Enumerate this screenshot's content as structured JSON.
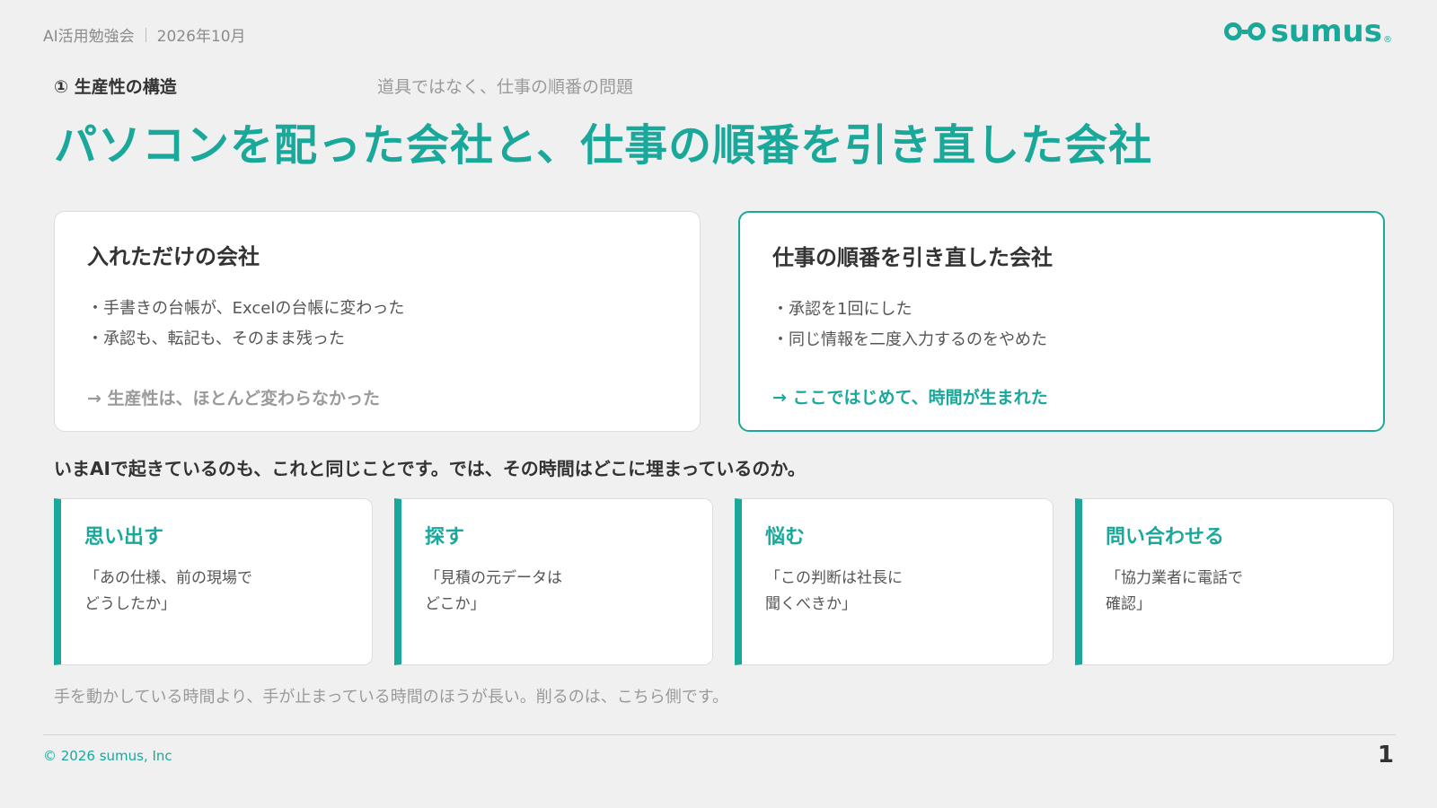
{
  "header": {
    "event": "AI活用勉強会",
    "date": "2026年10月",
    "logo_text": "sumus",
    "logo_mark": "®"
  },
  "section": {
    "label": "① 生産性の構造",
    "subtitle": "道具ではなく、仕事の順番の問題"
  },
  "title": "パソコンを配った会社と、仕事の順番を引き直した会社",
  "comparison": {
    "left": {
      "title": "入れただけの会社",
      "bullets": [
        "・手書きの台帳が、Excelの台帳に変わった",
        "・承認も、転記も、そのまま残った"
      ],
      "result": "→ 生産性は、ほとんど変わらなかった"
    },
    "right": {
      "title": "仕事の順番を引き直した会社",
      "bullets": [
        "・承認を1回にした",
        "・同じ情報を二度入力するのをやめた"
      ],
      "result": "→ ここではじめて、時間が生まれた"
    }
  },
  "lead": "いまAIで起きているのも、これと同じことです。では、その時間はどこに埋まっているのか。",
  "topics": [
    {
      "title": "思い出す",
      "quote_line1": "「あの仕様、前の現場で",
      "quote_line2": "どうしたか」"
    },
    {
      "title": "探す",
      "quote_line1": "「見積の元データは",
      "quote_line2": "どこか」"
    },
    {
      "title": "悩む",
      "quote_line1": "「この判断は社長に",
      "quote_line2": "聞くべきか」"
    },
    {
      "title": "問い合わせる",
      "quote_line1": "「協力業者に電話で",
      "quote_line2": "確認」"
    }
  ],
  "footnote": "手を動かしている時間より、手が止まっている時間のほうが長い。削るのは、こちら側です。",
  "footer": {
    "copyright": "© 2026 sumus, Inc",
    "page": "1"
  },
  "colors": {
    "accent": "#1aa89a",
    "background": "#f0f0f0",
    "text": "#333333",
    "muted": "#9a9a9a"
  }
}
